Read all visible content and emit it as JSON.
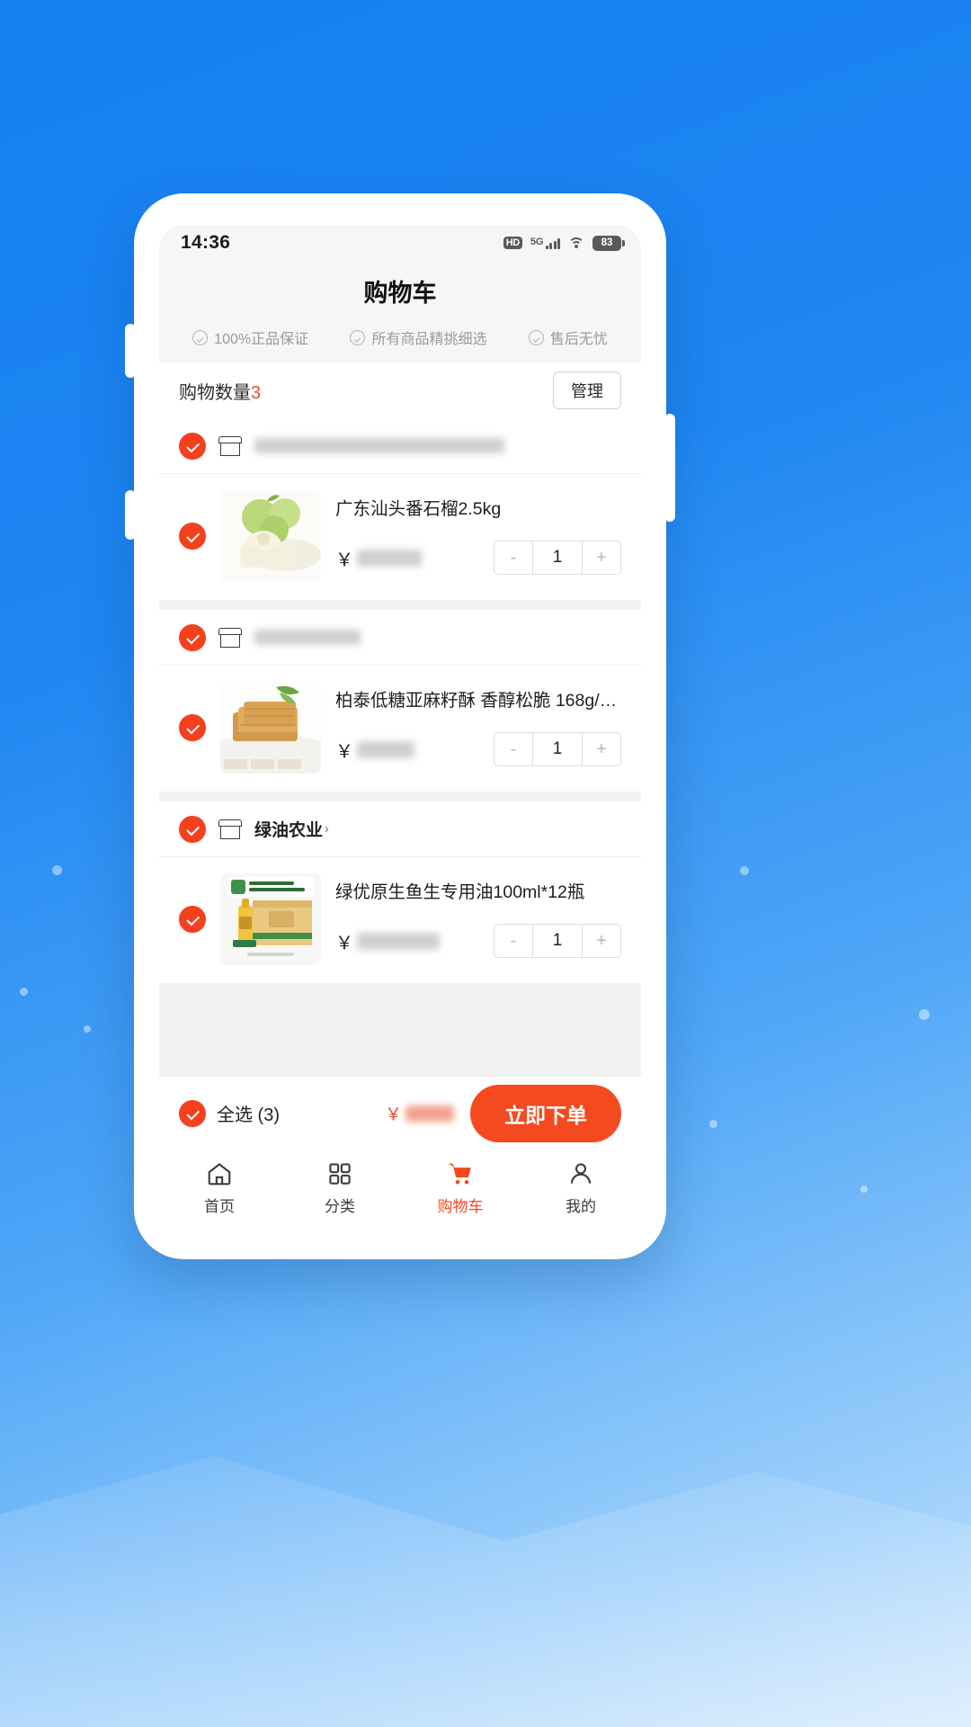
{
  "statusbar": {
    "time": "14:36",
    "hd": "HD",
    "network": "5G",
    "battery": "83",
    "icons": [
      "hd-icon",
      "5g-signal-icon",
      "wifi-icon",
      "battery-icon"
    ]
  },
  "header": {
    "title": "购物车",
    "badges": [
      {
        "icon": "check-circle-icon",
        "label": "100%正品保证"
      },
      {
        "icon": "check-circle-icon",
        "label": "所有商品精挑细选"
      },
      {
        "icon": "check-circle-icon",
        "label": "售后无忧"
      }
    ]
  },
  "count_row": {
    "label": "购物数量",
    "count": "3",
    "manage_label": "管理"
  },
  "groups": [
    {
      "shop_name": "",
      "shop_name_blurred": true,
      "shop_blur_width": 278,
      "checked": true,
      "items": [
        {
          "title": "广东汕头番石榴2.5kg",
          "currency": "￥",
          "price": "",
          "price_blurred": true,
          "price_blur_width": 72,
          "qty": "1",
          "checked": true,
          "image": "guava-fruit-photo"
        }
      ]
    },
    {
      "shop_name": "",
      "shop_name_blurred": true,
      "shop_blur_width": 118,
      "checked": true,
      "items": [
        {
          "title": "柏泰低糖亚麻籽酥 香醇松脆 168g/…",
          "currency": "￥",
          "price": "",
          "price_blurred": true,
          "price_blur_width": 64,
          "qty": "1",
          "checked": true,
          "image": "flaxseed-pastry-photo"
        }
      ]
    },
    {
      "shop_name": "绿油农业",
      "shop_name_blurred": false,
      "checked": true,
      "items": [
        {
          "title": "绿优原生鱼生专用油100ml*12瓶",
          "currency": "￥",
          "price": "",
          "price_blurred": true,
          "price_blur_width": 92,
          "qty": "1",
          "checked": true,
          "image": "cooking-oil-carton-photo"
        }
      ]
    }
  ],
  "bottom_bar": {
    "select_all_label": "全选 (3)",
    "total_currency": "￥",
    "total": "",
    "total_blurred": true,
    "order_button": "立即下单"
  },
  "tabbar": {
    "items": [
      {
        "icon": "home-icon",
        "label": "首页",
        "active": false
      },
      {
        "icon": "grid-icon",
        "label": "分类",
        "active": false
      },
      {
        "icon": "cart-icon",
        "label": "购物车",
        "active": true
      },
      {
        "icon": "person-icon",
        "label": "我的",
        "active": false
      }
    ]
  },
  "colors": {
    "accent": "#f5481e",
    "background": "#1e86f2",
    "price_red": "#f04a22"
  }
}
